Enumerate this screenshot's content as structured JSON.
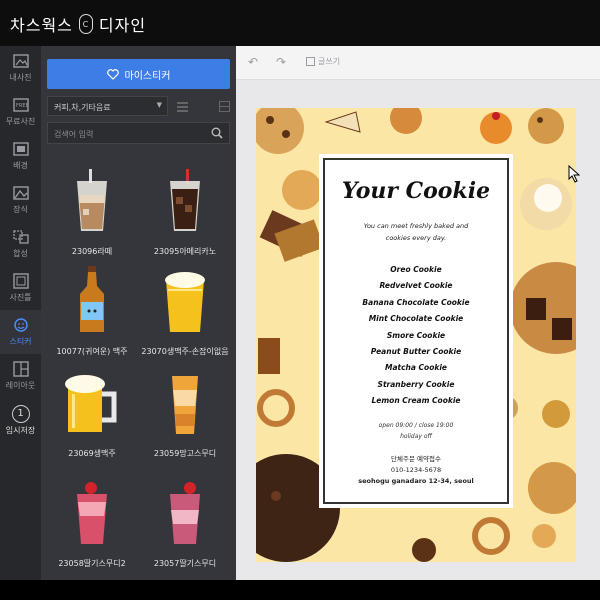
{
  "app": {
    "title": "차스웍스",
    "subtitle": "디자인",
    "logo_text": "C"
  },
  "nav": [
    {
      "label": "내사진",
      "icon": "photo-icon",
      "active": false
    },
    {
      "label": "무료사진",
      "icon": "free-photo-icon",
      "active": false
    },
    {
      "label": "배경",
      "icon": "background-icon",
      "active": false
    },
    {
      "label": "장식",
      "icon": "decoration-icon",
      "active": false
    },
    {
      "label": "합성",
      "icon": "composite-icon",
      "active": false
    },
    {
      "label": "사진틀",
      "icon": "frame-icon",
      "active": false
    },
    {
      "label": "스티커",
      "icon": "sticker-icon",
      "active": true
    },
    {
      "label": "레이아웃",
      "icon": "layout-icon",
      "active": false
    },
    {
      "label": "임시저장",
      "icon": "save-icon",
      "active": false,
      "number": "1"
    }
  ],
  "panel": {
    "my_sticker_label": "마이스티커",
    "category": "커피,차,기타음료",
    "search_placeholder": "검색어 입력",
    "stickers": [
      {
        "label": "23096라떼",
        "kind": "latte"
      },
      {
        "label": "23095아메리카노",
        "kind": "americano"
      },
      {
        "label": "10077(귀여운) 맥주",
        "kind": "beer-bottle"
      },
      {
        "label": "23070생맥주-손잡이없음",
        "kind": "beer-glass"
      },
      {
        "label": "23069생맥주",
        "kind": "beer-mug"
      },
      {
        "label": "23059망고스무디",
        "kind": "mango-smoothie"
      },
      {
        "label": "23058딸기스무디2",
        "kind": "strawberry-smoothie"
      },
      {
        "label": "23057딸기스무디",
        "kind": "strawberry-smoothie-2"
      }
    ]
  },
  "toolbar": {
    "write_label": "글쓰기"
  },
  "poster": {
    "title": "Your Cookie",
    "subtitle_line1": "You can meet freshly baked and",
    "subtitle_line2": "cookies every day.",
    "menu": [
      "Oreo Cookie",
      "Redvelvet Cookie",
      "Banana Chocolate Cookie",
      "Mint Chocolate Cookie",
      "Smore Cookie",
      "Peanut Butter Cookie",
      "Matcha Cookie",
      "Stranberry Cookie",
      "Lemon Cream Cookie"
    ],
    "hours_line1": "open 09:00 / close 19:00",
    "hours_line2": "holiday off",
    "store_name": "단체주문 예약접수",
    "phone": "010-1234-5678",
    "address": "seohogu ganadaro 12-34, seoul"
  },
  "colors": {
    "accent": "#3d7de6",
    "panel_bg": "#35363b",
    "nav_bg": "#27282c",
    "poster_bg": "#fbe6a6"
  }
}
